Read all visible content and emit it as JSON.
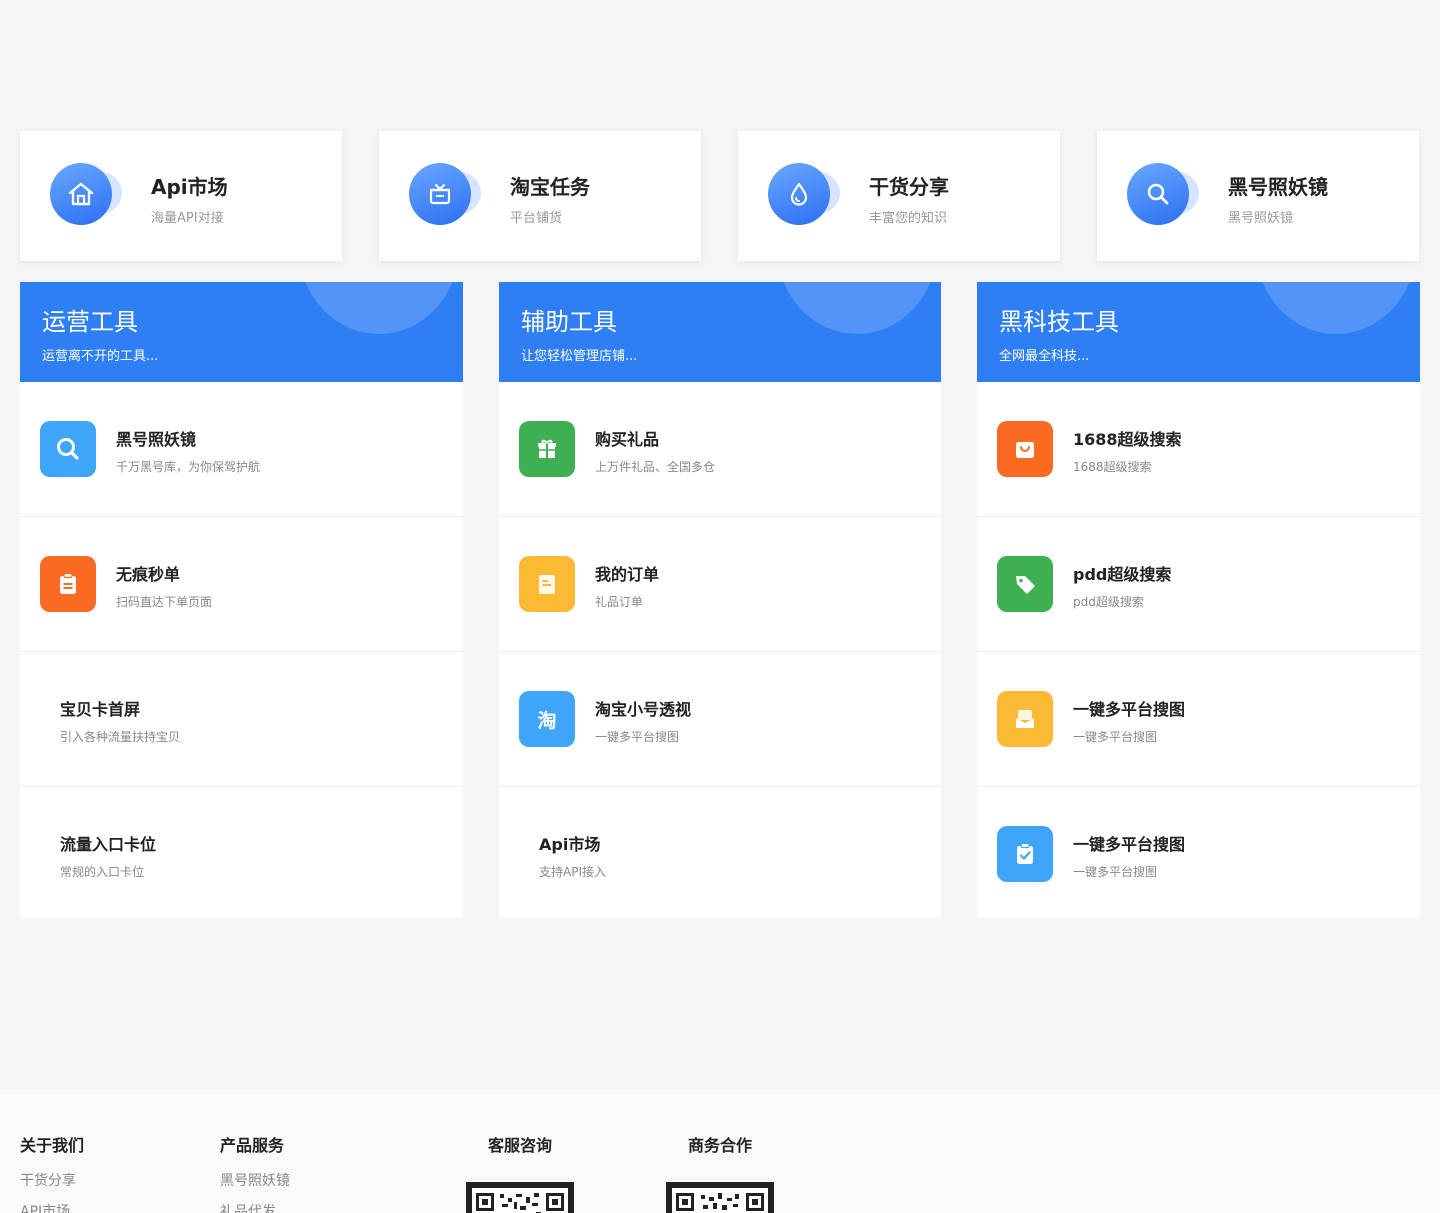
{
  "feature_cards": [
    {
      "title": "Api市场",
      "subtitle": "海量API对接",
      "icon": "home-icon"
    },
    {
      "title": "淘宝任务",
      "subtitle": "平台铺货",
      "icon": "gift-box-icon"
    },
    {
      "title": "干货分享",
      "subtitle": "丰富您的知识",
      "icon": "water-drop-icon"
    },
    {
      "title": "黑号照妖镜",
      "subtitle": "黑号照妖镜",
      "icon": "search-icon"
    }
  ],
  "columns": [
    {
      "title": "运营工具",
      "subtitle": "运营离不开的工具...",
      "items": [
        {
          "title": "黑号照妖镜",
          "desc": "千万黑号库，为你保驾护航",
          "icon": "search-icon",
          "color": "#3ea5f8"
        },
        {
          "title": "无痕秒单",
          "desc": "扫码直达下单页面",
          "icon": "clipboard-icon",
          "color": "#fa6a22"
        },
        {
          "title": "宝贝卡首屏",
          "desc": "引入各种流量扶持宝贝",
          "icon": "",
          "color": ""
        },
        {
          "title": "流量入口卡位",
          "desc": "常规的入口卡位",
          "icon": "",
          "color": ""
        }
      ]
    },
    {
      "title": "辅助工具",
      "subtitle": "让您轻松管理店铺...",
      "items": [
        {
          "title": "购买礼品",
          "desc": "上万件礼品、全国多仓",
          "icon": "gift-icon",
          "color": "#3fb052"
        },
        {
          "title": "我的订单",
          "desc": "礼品订单",
          "icon": "document-icon",
          "color": "#fbb934"
        },
        {
          "title": "淘宝小号透视",
          "desc": "一键多平台搜图",
          "icon": "taobao-icon",
          "color": "#3ea5f8",
          "glyph": "淘"
        },
        {
          "title": "Api市场",
          "desc": "支持API接入",
          "icon": "",
          "color": ""
        }
      ]
    },
    {
      "title": "黑科技工具",
      "subtitle": "全网最全科技...",
      "items": [
        {
          "title": "1688超级搜索",
          "desc": "1688超级搜索",
          "icon": "shopping-bag-icon",
          "color": "#fa6a22"
        },
        {
          "title": "pdd超级搜索",
          "desc": "pdd超级搜索",
          "icon": "tag-icon",
          "color": "#3fb052"
        },
        {
          "title": "一键多平台搜图",
          "desc": "一键多平台搜图",
          "icon": "envelope-icon",
          "color": "#fbb934"
        },
        {
          "title": "一键多平台搜图",
          "desc": "一键多平台搜图",
          "icon": "clipboard-check-icon",
          "color": "#3ea5f8"
        }
      ]
    }
  ],
  "footer": {
    "about": {
      "title": "关于我们",
      "links": [
        "干货分享",
        "API市场"
      ]
    },
    "products": {
      "title": "产品服务",
      "links": [
        "黑号照妖镜",
        "礼品代发"
      ]
    },
    "support": {
      "title": "客服咨询"
    },
    "business": {
      "title": "商务合作"
    }
  },
  "colors": {
    "primary": "#2e7ef4",
    "background": "#f5f5f5"
  }
}
